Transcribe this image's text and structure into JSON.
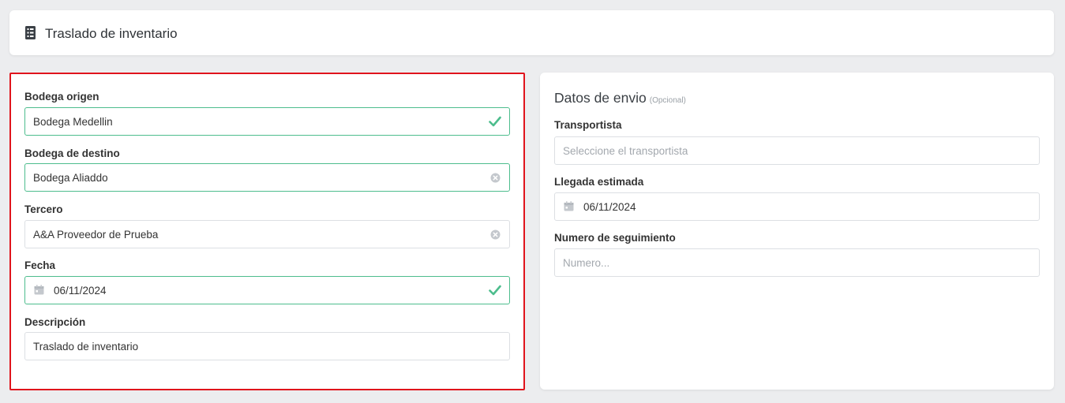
{
  "header": {
    "title": "Traslado de inventario",
    "icon": "list-icon"
  },
  "form": {
    "origin": {
      "label": "Bodega origen",
      "value": "Bodega Medellin",
      "status": "valid"
    },
    "destination": {
      "label": "Bodega de destino",
      "value": "Bodega Aliaddo"
    },
    "third_party": {
      "label": "Tercero",
      "value": "A&A Proveedor de Prueba"
    },
    "date": {
      "label": "Fecha",
      "value": "06/11/2024",
      "status": "valid"
    },
    "description": {
      "label": "Descripción",
      "value": "Traslado de inventario"
    }
  },
  "shipping": {
    "title": "Datos de envio",
    "optional": "(Opcional)",
    "carrier": {
      "label": "Transportista",
      "placeholder": "Seleccione el transportista"
    },
    "eta": {
      "label": "Llegada estimada",
      "value": "06/11/2024"
    },
    "tracking": {
      "label": "Numero de seguimiento",
      "placeholder": "Numero..."
    }
  },
  "colors": {
    "valid": "#4dbd8d",
    "highlight": "#e0141c",
    "background": "#ecedef"
  }
}
